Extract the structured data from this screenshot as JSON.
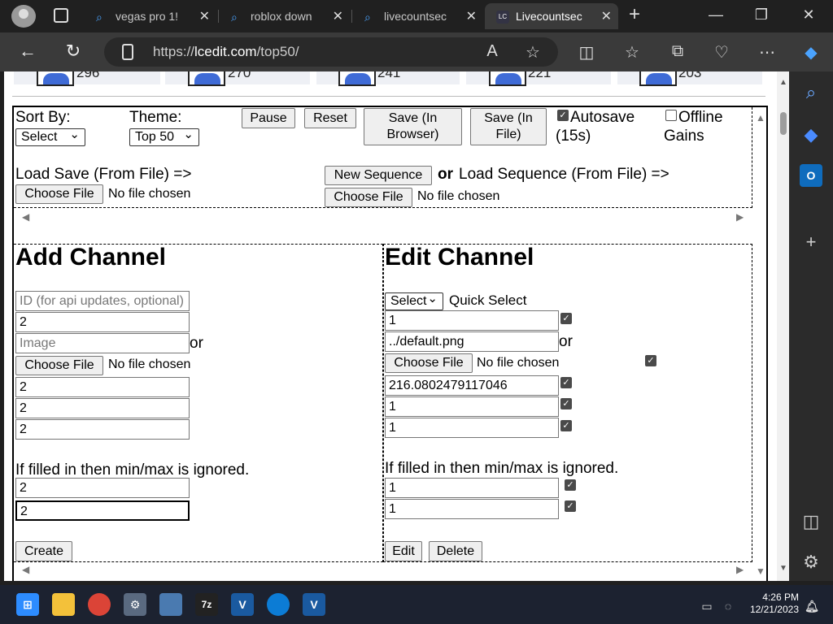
{
  "browser": {
    "tabs": [
      {
        "title": "vegas pro 1!"
      },
      {
        "title": "roblox down"
      },
      {
        "title": "livecountsec"
      },
      {
        "title": "Livecountsec"
      }
    ],
    "url_prefix": "https://",
    "url_host": "lcedit.com",
    "url_path": "/top50/",
    "new_tab": "+",
    "minimize": "—",
    "maximize": "❐",
    "close": "✕"
  },
  "top_counts": [
    "296",
    "270",
    "241",
    "221",
    "203"
  ],
  "controls": {
    "sort_by_label": "Sort By:",
    "sort_value": "Select",
    "theme_label": "Theme:",
    "theme_value": "Top 50",
    "pause": "Pause",
    "reset": "Reset",
    "save_browser": "Save (In Browser)",
    "save_file": "Save (In File)",
    "autosave": "Autosave (15s)",
    "offline_gains": "Offline Gains",
    "load_save_label": "Load Save (From File) =>",
    "new_sequence": "New Sequence",
    "or": "or",
    "load_sequence_label": "Load Sequence (From File) =>",
    "choose_file": "Choose File",
    "no_file": "No file chosen"
  },
  "add_channel": {
    "title": "Add Channel",
    "id_placeholder": "ID (for api updates, optional)",
    "name_value": "2",
    "image_placeholder": "Image",
    "or": "or",
    "count_value": "2",
    "min_value": "2",
    "max_value": "2",
    "note": "If filled in then min/max is ignored.",
    "rate_value": "2",
    "rate2_value": "2",
    "create": "Create"
  },
  "edit_channel": {
    "title": "Edit Channel",
    "select": "Select",
    "quick_select": "Quick Select",
    "name_value": "1",
    "image_value": "../default.png",
    "or": "or",
    "count_value": "216.0802479117046",
    "min_value": "1",
    "max_value": "1",
    "note": "If filled in then min/max is ignored.",
    "rate_value": "1",
    "rate2_value": "1",
    "edit": "Edit",
    "delete": "Delete"
  },
  "taskbar": {
    "time": "4:26 PM",
    "date": "12/21/2023"
  },
  "colors": {
    "accent": "#3f6bd6",
    "titlebar": "#202020",
    "taskbar": "#1c2230"
  }
}
